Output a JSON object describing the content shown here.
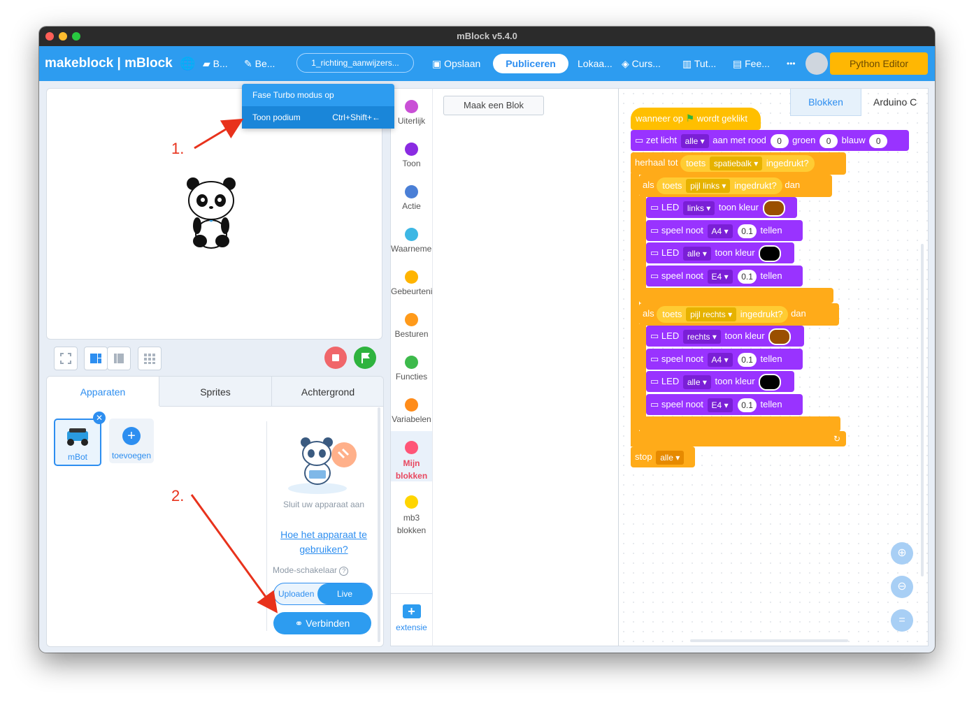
{
  "window": {
    "title": "mBlock v5.4.0"
  },
  "menubar": {
    "brand": "makeblock | mBlock",
    "file_short": "B...",
    "edit_short": "Be...",
    "project_name": "1_richting_aanwijzers...",
    "save_label": "Opslaan",
    "publish_label": "Publiceren",
    "classroom_label": "Lokaa...",
    "courses_label": "Curs...",
    "tutorials_label": "Tut...",
    "feedback_label": "Fee...",
    "more_label": "•••",
    "python_editor_label": "Python Editor"
  },
  "stage_menu": {
    "items": [
      {
        "label": "Fase Turbo modus op",
        "shortcut": ""
      },
      {
        "label": "Toon podium",
        "shortcut": "Ctrl+Shift+←"
      }
    ]
  },
  "annotations": {
    "step1": "1.",
    "step2": "2."
  },
  "devices_panel": {
    "tabs": [
      "Apparaten",
      "Sprites",
      "Achtergrond"
    ],
    "device_name": "mBot",
    "add_label": "toevoegen",
    "connect_hint": "Sluit uw apparaat aan",
    "help_link": "Hoe het apparaat te gebruiken?",
    "mode_label": "Mode-schakelaar",
    "mode_options": [
      "Uploaden",
      "Live"
    ],
    "mode_selected": "Live",
    "connect_button": "Verbinden"
  },
  "categories": [
    {
      "label": "Uiterlijk",
      "color": "#c94fd6"
    },
    {
      "label": "Toon",
      "color": "#8a2be2"
    },
    {
      "label": "Actie",
      "color": "#4a7fd6"
    },
    {
      "label": "Waarnemen",
      "color": "#3db7e4"
    },
    {
      "label": "Gebeurtenis",
      "color": "#ffb400"
    },
    {
      "label": "Besturen",
      "color": "#ff9a1a"
    },
    {
      "label": "Functies",
      "color": "#3dba4b"
    },
    {
      "label": "Variabelen",
      "color": "#ff8c1a"
    },
    {
      "label": "Mijn blokken",
      "color": "#ff5577",
      "active": true
    },
    {
      "label": "mb3 blokken",
      "color": "#ffd500"
    }
  ],
  "extension_label": "extensie",
  "palette": {
    "make_block_button": "Maak een Blok"
  },
  "script_tabs": [
    "Blokken",
    "Arduino C"
  ],
  "script": {
    "hat": {
      "text1": "wanneer op",
      "text2": "wordt geklikt"
    },
    "set_light": {
      "text": "zet licht",
      "target": "alle",
      "r_label": "aan met rood",
      "r": "0",
      "g_label": "groen",
      "g": "0",
      "b_label": "blauw",
      "b": "0"
    },
    "repeat_until": {
      "text": "herhaal tot",
      "key_text": "toets",
      "key": "spatiebalk",
      "pressed": "ingedrukt?"
    },
    "if1": {
      "als": "als",
      "key_text": "toets",
      "key": "pijl links",
      "pressed": "ingedrukt?",
      "dan": "dan"
    },
    "if1_body": [
      {
        "kind": "led",
        "label": "LED",
        "target": "links",
        "verb": "toon kleur",
        "color": "#9a4f00"
      },
      {
        "kind": "note",
        "label": "speel noot",
        "note": "A4",
        "beats": "0.1",
        "unit": "tellen"
      },
      {
        "kind": "led",
        "label": "LED",
        "target": "alle",
        "verb": "toon kleur",
        "color": "#000000"
      },
      {
        "kind": "note",
        "label": "speel noot",
        "note": "E4",
        "beats": "0.1",
        "unit": "tellen"
      }
    ],
    "if2": {
      "als": "als",
      "key_text": "toets",
      "key": "pijl rechts",
      "pressed": "ingedrukt?",
      "dan": "dan"
    },
    "if2_body": [
      {
        "kind": "led",
        "label": "LED",
        "target": "rechts",
        "verb": "toon kleur",
        "color": "#9a4f00"
      },
      {
        "kind": "note",
        "label": "speel noot",
        "note": "A4",
        "beats": "0.1",
        "unit": "tellen"
      },
      {
        "kind": "led",
        "label": "LED",
        "target": "alle",
        "verb": "toon kleur",
        "color": "#000000"
      },
      {
        "kind": "note",
        "label": "speel noot",
        "note": "E4",
        "beats": "0.1",
        "unit": "tellen"
      }
    ],
    "stop": {
      "text": "stop",
      "target": "alle"
    }
  },
  "colors": {
    "accent": "#2d9cf0",
    "events": "#ffbf00",
    "control": "#ffab19",
    "mbot": "#9933ff",
    "sensing": "#ffcc33",
    "annotation": "#e8321c"
  }
}
